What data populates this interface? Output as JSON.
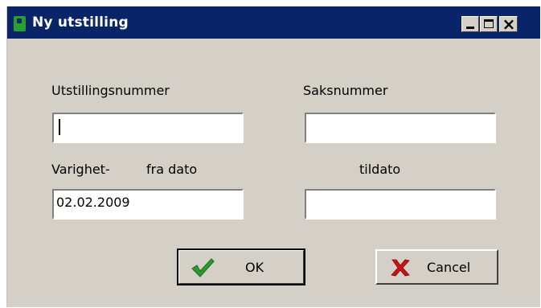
{
  "window": {
    "title": "Ny utstilling"
  },
  "form": {
    "utstillingsnummer_label": "Utstillingsnummer",
    "utstillingsnummer_value": "",
    "saksnummer_label": "Saksnummer",
    "saksnummer_value": "",
    "varighet_label": "Varighet-",
    "fra_dato_label": "fra dato",
    "fra_dato_value": "02.02.2009",
    "tildato_label": "tildato",
    "tildato_value": ""
  },
  "buttons": {
    "ok_label": "OK",
    "cancel_label": "Cancel"
  },
  "icons": {
    "app": "app-icon",
    "ok": "checkmark-icon",
    "cancel": "red-x-icon"
  },
  "colors": {
    "titlebar": "#0a246a",
    "window_bg": "#d4d0c8",
    "ok_icon": "#2e9a2e",
    "cancel_icon": "#cc1111"
  }
}
